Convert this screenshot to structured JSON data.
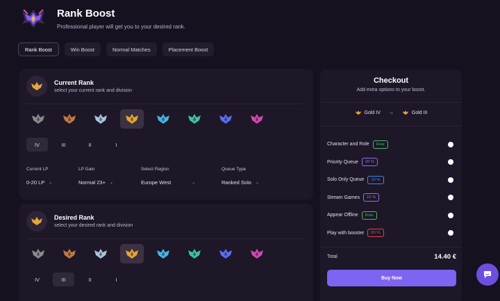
{
  "header": {
    "title": "Rank Boost",
    "subtitle": "Professional player will get you to your desired rank."
  },
  "tabs": [
    {
      "label": "Rank Boost",
      "active": true
    },
    {
      "label": "Win Boost",
      "active": false
    },
    {
      "label": "Normal Matches",
      "active": false
    },
    {
      "label": "Placement Boost",
      "active": false
    }
  ],
  "current_rank": {
    "title": "Current Rank",
    "subtitle": "select your current rank and division",
    "emblem_colors": [
      "#8a8a8a",
      "#c07a42",
      "#a8c4d8",
      "#e6a634",
      "#47b4e6",
      "#3bc2a8",
      "#5b6ef2",
      "#d447b0"
    ],
    "selected_emblem": 3,
    "divisions": [
      "IV",
      "III",
      "II",
      "I"
    ],
    "selected_division": 0,
    "options": [
      {
        "label": "Current LP",
        "value": "0-20 LP"
      },
      {
        "label": "LP Gain",
        "value": "Normal 23+"
      },
      {
        "label": "Select Region",
        "value": "Europe West"
      },
      {
        "label": "Queue Type",
        "value": "Ranked Solo"
      }
    ]
  },
  "desired_rank": {
    "title": "Desired Rank",
    "subtitle": "select your desired rank and division",
    "selected_emblem": 3,
    "divisions": [
      "IV",
      "III",
      "II",
      "I"
    ],
    "selected_division": 1
  },
  "checkout": {
    "title": "Checkout",
    "subtitle": "Add extra options to your boost.",
    "from_rank": "Gold IV",
    "arrow": "→",
    "to_rank": "Gold III",
    "options": [
      {
        "label": "Character and Role",
        "tag": "Free",
        "tag_color": "#3fbf6a"
      },
      {
        "label": "Priority Queue",
        "tag": "20 %",
        "tag_color": "#9a6cf0"
      },
      {
        "label": "Solo Only Queue",
        "tag": "10 %",
        "tag_color": "#4a86e8"
      },
      {
        "label": "Stream Games",
        "tag": "15 %",
        "tag_color": "#9a6cf0"
      },
      {
        "label": "Appear Offline",
        "tag": "Free",
        "tag_color": "#3fbf6a"
      },
      {
        "label": "Play with booster",
        "tag": "60 %",
        "tag_color": "#e0464d"
      }
    ],
    "total_label": "Total",
    "total_value": "14.40 €",
    "buy_label": "Buy Now"
  }
}
